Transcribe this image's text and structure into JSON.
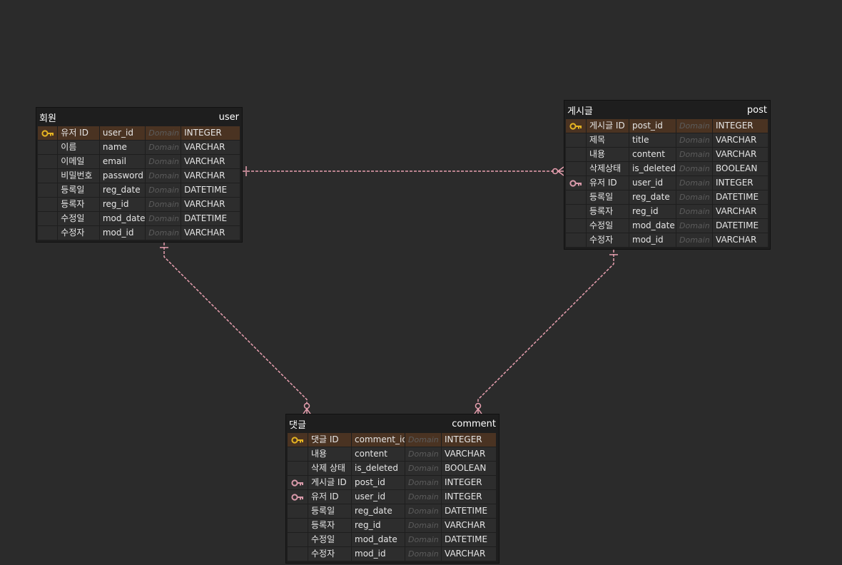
{
  "entities": [
    {
      "id": "user",
      "logical": "회원",
      "physical": "user",
      "columns": [
        {
          "key": "pk",
          "logical": "유저 ID",
          "physical": "user_id",
          "domain": "Domain",
          "type": "INTEGER"
        },
        {
          "key": "",
          "logical": "이름",
          "physical": "name",
          "domain": "Domain",
          "type": "VARCHAR"
        },
        {
          "key": "",
          "logical": "이메일",
          "physical": "email",
          "domain": "Domain",
          "type": "VARCHAR"
        },
        {
          "key": "",
          "logical": "비밀번호",
          "physical": "password",
          "domain": "Domain",
          "type": "VARCHAR"
        },
        {
          "key": "",
          "logical": "등록일",
          "physical": "reg_date",
          "domain": "Domain",
          "type": "DATETIME"
        },
        {
          "key": "",
          "logical": "등록자",
          "physical": "reg_id",
          "domain": "Domain",
          "type": "VARCHAR"
        },
        {
          "key": "",
          "logical": "수정일",
          "physical": "mod_date",
          "domain": "Domain",
          "type": "DATETIME"
        },
        {
          "key": "",
          "logical": "수정자",
          "physical": "mod_id",
          "domain": "Domain",
          "type": "VARCHAR"
        }
      ]
    },
    {
      "id": "post",
      "logical": "게시글",
      "physical": "post",
      "columns": [
        {
          "key": "pk",
          "logical": "게시글 ID",
          "physical": "post_id",
          "domain": "Domain",
          "type": "INTEGER"
        },
        {
          "key": "",
          "logical": "제목",
          "physical": "title",
          "domain": "Domain",
          "type": "VARCHAR"
        },
        {
          "key": "",
          "logical": "내용",
          "physical": "content",
          "domain": "Domain",
          "type": "VARCHAR"
        },
        {
          "key": "",
          "logical": "삭제상태",
          "physical": "is_deleted",
          "domain": "Domain",
          "type": "BOOLEAN"
        },
        {
          "key": "fk",
          "logical": "유저 ID",
          "physical": "user_id",
          "domain": "Domain",
          "type": "INTEGER"
        },
        {
          "key": "",
          "logical": "등록일",
          "physical": "reg_date",
          "domain": "Domain",
          "type": "DATETIME"
        },
        {
          "key": "",
          "logical": "등록자",
          "physical": "reg_id",
          "domain": "Domain",
          "type": "VARCHAR"
        },
        {
          "key": "",
          "logical": "수정일",
          "physical": "mod_date",
          "domain": "Domain",
          "type": "DATETIME"
        },
        {
          "key": "",
          "logical": "수정자",
          "physical": "mod_id",
          "domain": "Domain",
          "type": "VARCHAR"
        }
      ]
    },
    {
      "id": "comment",
      "logical": "댓글",
      "physical": "comment",
      "columns": [
        {
          "key": "pk",
          "logical": "댓글 ID",
          "physical": "comment_id",
          "domain": "Domain",
          "type": "INTEGER"
        },
        {
          "key": "",
          "logical": "내용",
          "physical": "content",
          "domain": "Domain",
          "type": "VARCHAR"
        },
        {
          "key": "",
          "logical": "삭제 상태",
          "physical": "is_deleted",
          "domain": "Domain",
          "type": "BOOLEAN"
        },
        {
          "key": "fk",
          "logical": "게시글 ID",
          "physical": "post_id",
          "domain": "Domain",
          "type": "INTEGER"
        },
        {
          "key": "fk",
          "logical": "유저 ID",
          "physical": "user_id",
          "domain": "Domain",
          "type": "INTEGER"
        },
        {
          "key": "",
          "logical": "등록일",
          "physical": "reg_date",
          "domain": "Domain",
          "type": "DATETIME"
        },
        {
          "key": "",
          "logical": "등록자",
          "physical": "reg_id",
          "domain": "Domain",
          "type": "VARCHAR"
        },
        {
          "key": "",
          "logical": "수정일",
          "physical": "mod_date",
          "domain": "Domain",
          "type": "DATETIME"
        },
        {
          "key": "",
          "logical": "수정자",
          "physical": "mod_id",
          "domain": "Domain",
          "type": "VARCHAR"
        }
      ]
    }
  ],
  "relationships": [
    {
      "from": "user",
      "to": "post",
      "cardinality": "one-to-zero-or-many"
    },
    {
      "from": "user",
      "to": "comment",
      "cardinality": "one-to-zero-or-many"
    },
    {
      "from": "post",
      "to": "comment",
      "cardinality": "one-to-zero-or-many"
    }
  ],
  "colors": {
    "background": "#2b2b2b",
    "pk_row": "#4a3322",
    "pk_icon": "#e6b422",
    "fk_icon": "#d99aaa",
    "relationship_line": "#e8a0b0"
  }
}
